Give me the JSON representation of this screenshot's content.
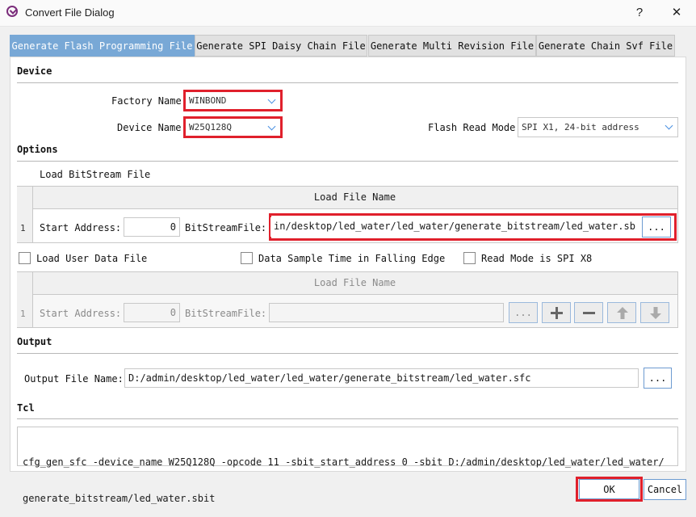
{
  "window": {
    "title": "Convert File Dialog",
    "help_label": "?",
    "close_label": "✕"
  },
  "tabs": [
    {
      "label": "Generate Flash Programming File"
    },
    {
      "label": "Generate SPI Daisy Chain File"
    },
    {
      "label": "Generate Multi Revision File"
    },
    {
      "label": "Generate Chain Svf File"
    }
  ],
  "device": {
    "section_title": "Device",
    "factory_label": "Factory Name",
    "factory_value": "WINBOND",
    "device_label": "Device Name",
    "device_value": "W25Q128Q",
    "read_mode_label": "Flash Read Mode",
    "read_mode_value": "SPI X1, 24-bit address"
  },
  "options": {
    "section_title": "Options",
    "load_bitstream_label": "Load BitStream File",
    "grid_header": "Load File Name",
    "row_number": "1",
    "start_address_label": "Start Address:",
    "start_address_value": "0",
    "bitstream_label": "BitStreamFile:",
    "bitstream_value": "in/desktop/led_water/led_water/generate_bitstream/led_water.sbit",
    "browse_label": "...",
    "load_user_data_label": "Load User Data File",
    "data_sample_label": "Data Sample Time in Falling Edge",
    "read_mode_x8_label": "Read Mode is SPI X8",
    "user_grid_header": "Load File Name",
    "user_row_number": "1",
    "user_start_address_label": "Start Address:",
    "user_start_address_value": "0",
    "user_bitstream_label": "BitStreamFile:",
    "user_browse_label": "..."
  },
  "output": {
    "section_title": "Output",
    "file_name_label": "Output File Name:",
    "file_name_value": "D:/admin/desktop/led_water/led_water/generate_bitstream/led_water.sfc",
    "browse_label": "..."
  },
  "tcl": {
    "section_title": "Tcl",
    "command_line1": "cfg_gen_sfc -device_name W25Q128Q -opcode 11 -sbit_start_address 0 -sbit D:/admin/desktop/led_water/led_water/",
    "command_line2": "generate_bitstream/led_water.sbit"
  },
  "buttons": {
    "ok_label": "OK",
    "cancel_label": "Cancel"
  },
  "colors": {
    "active_tab": "#78a8d6",
    "highlight": "#e0202c",
    "accent": "#4a90e2"
  }
}
